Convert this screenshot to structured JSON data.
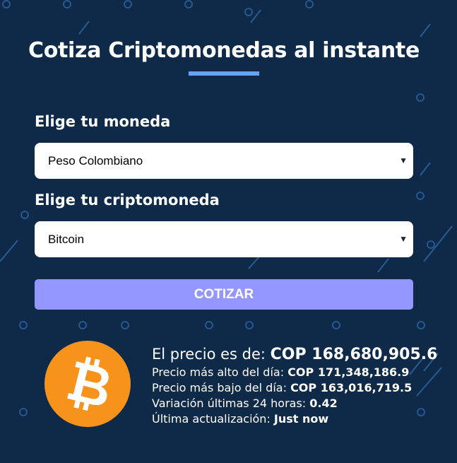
{
  "header": {
    "title": "Cotiza Criptomonedas al instante"
  },
  "form": {
    "currency_label": "Elige tu moneda",
    "currency_value": "Peso Colombiano",
    "crypto_label": "Elige tu criptomoneda",
    "crypto_value": "Bitcoin",
    "submit_label": "COTIZAR"
  },
  "result": {
    "price_label": "El precio es de: ",
    "price_value": "COP 168,680,905.6",
    "high_label": "Precio más alto del día: ",
    "high_value": "COP 171,348,186.9",
    "low_label": "Precio más bajo del día: ",
    "low_value": "COP 163,016,719.5",
    "change_label": "Variación últimas 24 horas: ",
    "change_value": "0.42",
    "updated_label": "Última actualización: ",
    "updated_value": "Just now"
  },
  "icons": {
    "coin": "bitcoin-icon",
    "select_arrow": "chevron-down-icon"
  },
  "colors": {
    "background": "#0e2a48",
    "accent": "#66a2fe",
    "button": "#9497ff",
    "bitcoin": "#f7931a"
  }
}
